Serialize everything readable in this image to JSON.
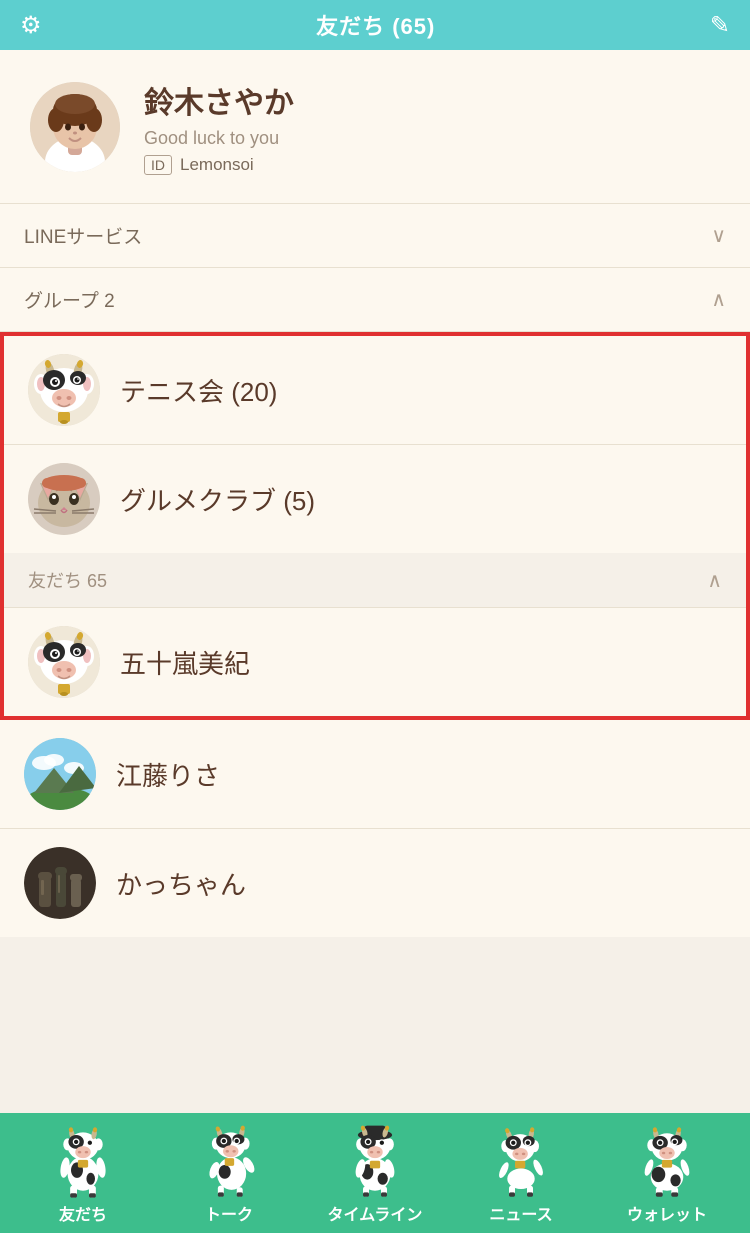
{
  "header": {
    "title": "友だち (65)",
    "gear_icon": "⚙",
    "add_icon": "+"
  },
  "profile": {
    "name": "鈴木さやか",
    "status": "Good luck to you",
    "id_label": "ID",
    "id_value": "Lemonsoi"
  },
  "sections": {
    "line_service_label": "LINEサービス",
    "groups_label": "グループ 2",
    "friends_label": "友だち 65"
  },
  "groups": [
    {
      "name": "テニス会 (20)",
      "avatar_type": "cow"
    },
    {
      "name": "グルメクラブ (5)",
      "avatar_type": "cat"
    }
  ],
  "friends": [
    {
      "name": "五十嵐美紀",
      "avatar_type": "cow"
    },
    {
      "name": "江藤りさ",
      "avatar_type": "sky"
    },
    {
      "name": "かっちゃん",
      "avatar_type": "dark"
    }
  ],
  "nav": {
    "items": [
      {
        "label": "友だち",
        "icon": "cow-stand"
      },
      {
        "label": "トーク",
        "icon": "cow-talk"
      },
      {
        "label": "タイムライン",
        "icon": "cow-timeline"
      },
      {
        "label": "ニュース",
        "icon": "cow-news"
      },
      {
        "label": "ウォレット",
        "icon": "cow-wallet"
      }
    ]
  },
  "colors": {
    "header_bg": "#5dcfcf",
    "accent_red": "#e03030",
    "nav_bg": "#3dbe8c",
    "text_dark": "#5a3a2a",
    "text_muted": "#a09080"
  }
}
